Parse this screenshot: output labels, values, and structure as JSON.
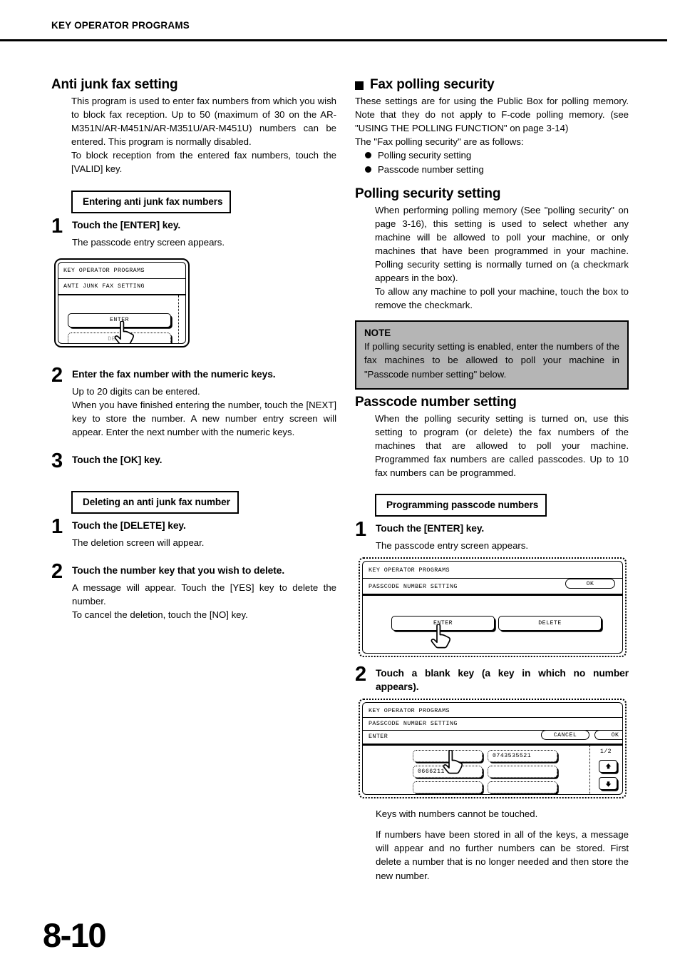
{
  "header": {
    "title": "KEY OPERATOR PROGRAMS"
  },
  "page_number": "8-10",
  "left_column": {
    "section1": {
      "heading": "Anti junk fax setting",
      "paragraphs": [
        "This program is used to enter fax numbers from which you wish to block fax reception. Up to 50 (maximum of 30 on the AR-M351N/AR-M451N/AR-M351U/AR-M451U) numbers can be entered. This program is normally disabled.",
        "To block reception from the entered fax numbers, touch the [VALID] key."
      ],
      "boxed_heading_1": "Entering anti junk fax numbers",
      "steps1": [
        {
          "num": "1",
          "title": "Touch the [ENTER] key.",
          "desc": "The passcode entry screen appears."
        },
        {
          "num": "2",
          "title": "Enter the fax number with the numeric keys.",
          "desc": "Up to 20 digits can be entered.\nWhen you have finished entering the number, touch the [NEXT] key to store the number. A new number entry screen will appear. Enter the next number with the numeric keys."
        },
        {
          "num": "3",
          "title": "Touch the [OK] key.",
          "desc": ""
        }
      ],
      "boxed_heading_2": "Deleting an anti junk fax number",
      "steps2": [
        {
          "num": "1",
          "title": "Touch the [DELETE] key.",
          "desc": "The deletion screen will appear."
        },
        {
          "num": "2",
          "title": "Touch the number key that you wish to delete.",
          "desc": "A message will appear. Touch the [YES] key to delete the number.\nTo cancel the deletion, touch the [NO] key."
        }
      ],
      "lcd_screen": {
        "title": "KEY OPERATOR PROGRAMS",
        "subtitle": "ANTI JUNK FAX SETTING",
        "buttons": [
          {
            "label": "ENTER",
            "state": "solid"
          },
          {
            "label": "DELETE",
            "state": "dotted"
          }
        ]
      }
    }
  },
  "right_column": {
    "section1": {
      "heading": "Fax polling security",
      "paragraphs": [
        "These settings are for using the Public Box for polling memory. Note that they do not apply to F-code polling memory. (see \"USING THE POLLING FUNCTION\" on page 3-14)",
        "The \"Fax polling security\" are as follows:"
      ],
      "bullets": [
        "Polling security setting",
        "Passcode number setting"
      ]
    },
    "section2": {
      "heading": "Polling security setting",
      "paragraphs": [
        "When performing polling memory (See \"polling security\" on page 3-16), this setting is used to select whether any machine will be allowed to poll your machine, or only machines that have been programmed in your machine. Polling security setting is normally turned on (a checkmark appears in the box).",
        "To allow any machine to poll your machine, touch the box to remove the checkmark."
      ]
    },
    "note": {
      "label": "NOTE",
      "text": "If polling security setting is enabled, enter the numbers of the fax machines to be allowed to poll your machine in \"Passcode number setting\" below."
    },
    "section3": {
      "heading": "Passcode number setting",
      "paragraphs": [
        "When the polling security setting is turned on, use this setting to program (or delete) the fax numbers of the machines that are allowed to poll your machine. Programmed fax numbers are called passcodes. Up to 10 fax numbers can be programmed."
      ],
      "boxed_heading": "Programming passcode numbers",
      "steps": [
        {
          "num": "1",
          "title": "Touch the [ENTER] key.",
          "desc": "The passcode entry screen appears."
        },
        {
          "num": "2",
          "title": "Touch a blank key (a key in which no number appears).",
          "desc": "Keys with numbers cannot be touched.\nIf numbers have been stored in all of the keys, a message will appear and no further numbers can be stored. First delete a number that is no longer needed and then store the new number."
        }
      ],
      "trailing_paragraphs": [
        "Keys with numbers cannot be touched.",
        "If numbers have been stored in all of the keys, a message will appear and no further numbers can be stored. First delete a number that is no longer needed and then store the new number."
      ],
      "lcd_screen_1": {
        "title": "KEY OPERATOR PROGRAMS",
        "subtitle": "PASSCODE NUMBER SETTING",
        "ok_label": "OK",
        "buttons": [
          {
            "label": "ENTER"
          },
          {
            "label": "DELETE"
          }
        ]
      },
      "lcd_screen_2": {
        "title": "KEY OPERATOR PROGRAMS",
        "subtitle": "PASSCODE NUMBER SETTING",
        "mode_label": "ENTER",
        "cancel_label": "CANCEL",
        "ok_label": "OK",
        "page_indicator": "1/2",
        "keys": [
          {
            "value": "",
            "pos": "left-1"
          },
          {
            "value": "0743535521",
            "pos": "right-1"
          },
          {
            "value": "0666211",
            "pos": "left-2"
          },
          {
            "value": "",
            "pos": "right-2"
          },
          {
            "value": "",
            "pos": "left-3"
          },
          {
            "value": "",
            "pos": "right-3"
          }
        ],
        "up_arrow": "▲",
        "down_arrow": "▼"
      }
    }
  }
}
